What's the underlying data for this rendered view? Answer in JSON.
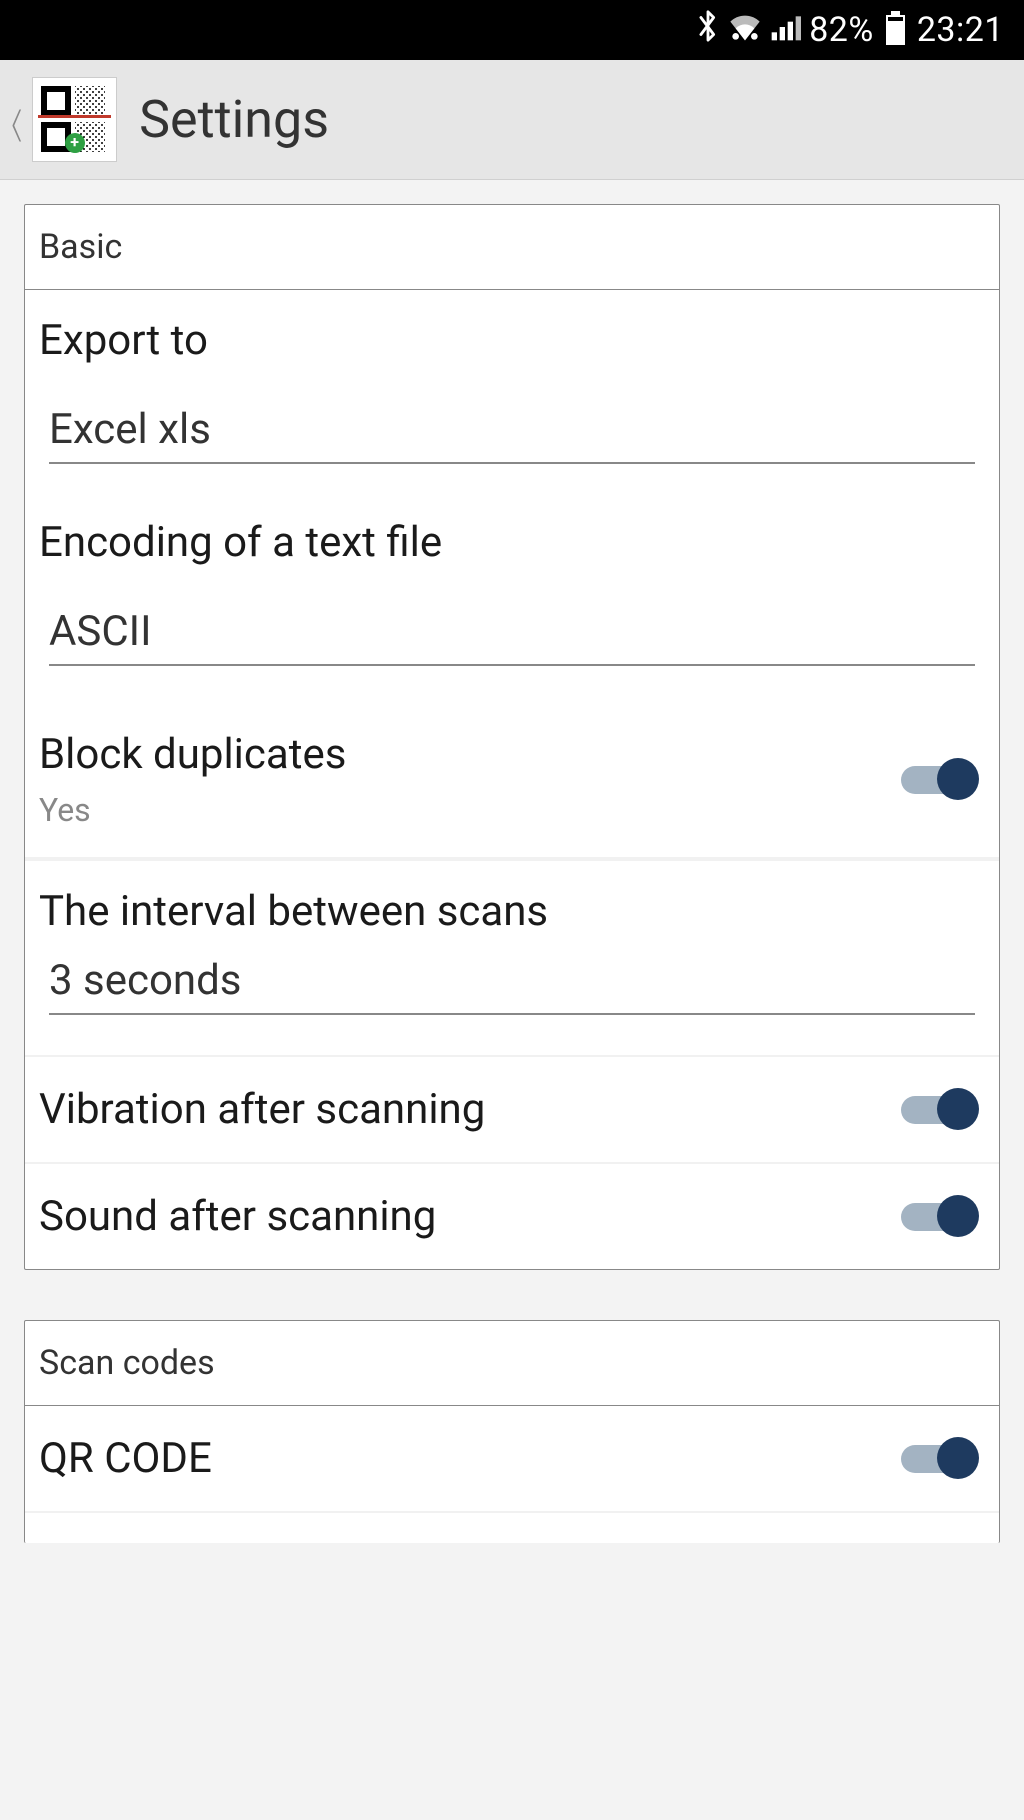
{
  "status_bar": {
    "battery_percent": "82%",
    "time": "23:21"
  },
  "header": {
    "title": "Settings"
  },
  "sections": {
    "basic": {
      "title": "Basic",
      "export_to": {
        "label": "Export to",
        "value": "Excel xls"
      },
      "encoding": {
        "label": "Encoding of a text file",
        "value": "ASCII"
      },
      "block_duplicates": {
        "label": "Block duplicates",
        "sub": "Yes",
        "on": true
      },
      "interval": {
        "label": "The interval between scans",
        "value": "3 seconds"
      },
      "vibration": {
        "label": "Vibration after scanning",
        "on": true
      },
      "sound": {
        "label": "Sound after scanning",
        "on": true
      }
    },
    "scan_codes": {
      "title": "Scan codes",
      "qr_code": {
        "label": "QR CODE",
        "on": true
      }
    }
  }
}
